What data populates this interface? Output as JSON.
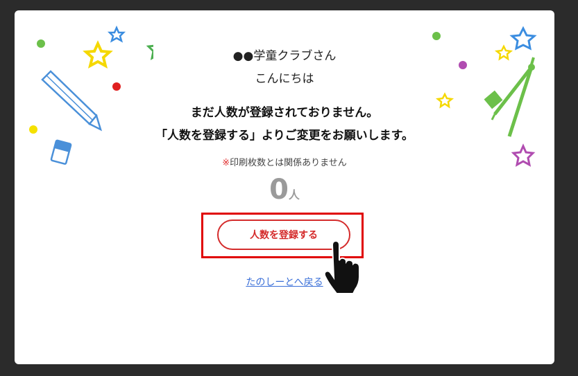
{
  "dialog": {
    "greeting_name": "●●学童クラブさん",
    "greeting_hello": "こんにちは",
    "message_line1": "まだ人数が登録されておりません。",
    "message_line2": "「人数を登録する」よりご変更をお願いします。",
    "note_mark": "※",
    "note_text": "印刷枚数とは関係ありません",
    "count_value": "0",
    "count_unit": "人",
    "register_button_label": "人数を登録する",
    "back_link_label": "たのしーとへ戻る"
  },
  "colors": {
    "accent_red": "#d42b2b",
    "highlight_red": "#e00000",
    "link_blue": "#3a6fd8",
    "count_gray": "#9a9a9a"
  },
  "icons": [
    "star-icon",
    "pencil-icon",
    "eraser-icon",
    "compass-icon",
    "dot-icon",
    "hand-pointer-icon"
  ]
}
